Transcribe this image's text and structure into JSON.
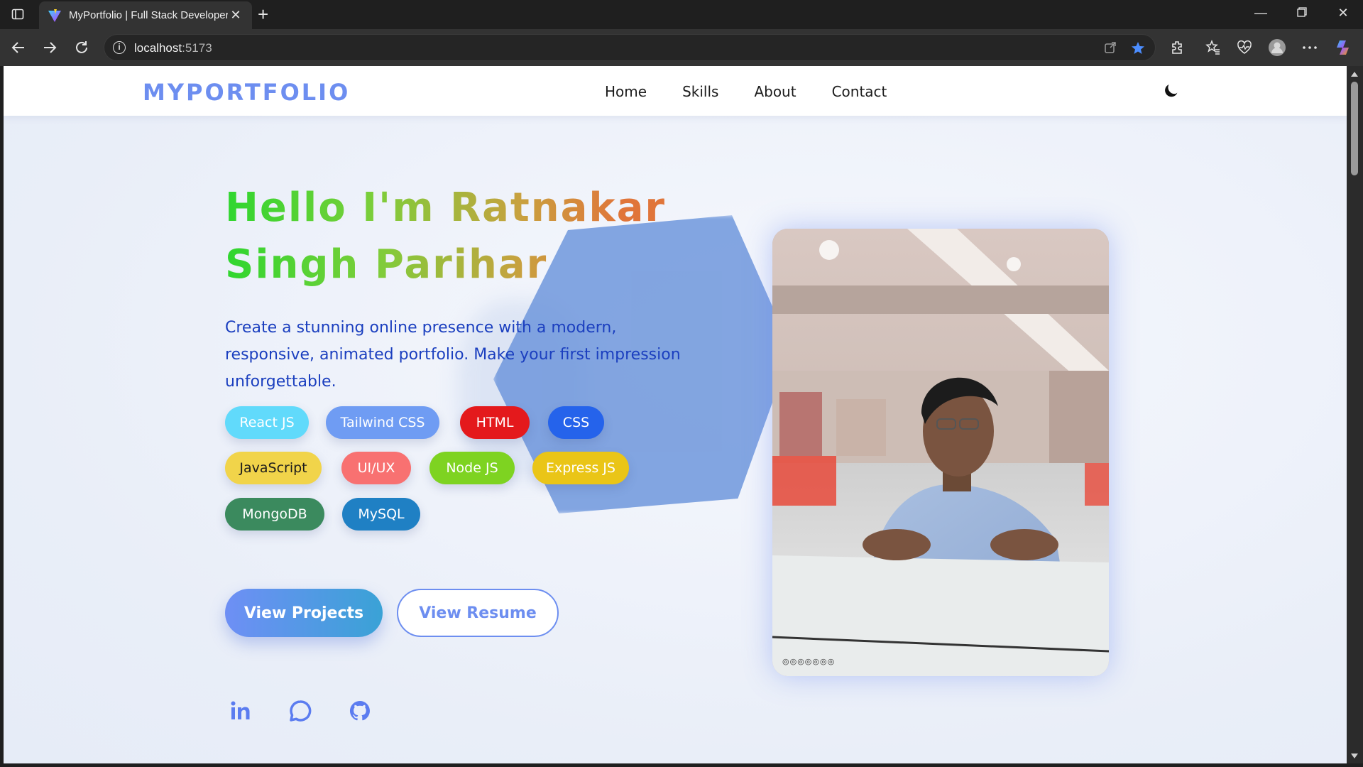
{
  "browser": {
    "tab_title": "MyPortfolio | Full Stack Developer",
    "url_host": "localhost",
    "url_port": ":5173"
  },
  "nav": {
    "logo": "MYPORTFOLIO",
    "links": [
      "Home",
      "Skills",
      "About",
      "Contact"
    ]
  },
  "hero": {
    "title_line1": "Hello I'm Ratnakar",
    "title_line2": "Singh Parihar",
    "description": "Create a stunning online presence with a modern, responsive, animated portfolio. Make your first impression unforgettable.",
    "skills": [
      {
        "label": "React JS",
        "color": "#61dafb"
      },
      {
        "label": "Tailwind CSS",
        "color": "#6f9cf3"
      },
      {
        "label": "HTML",
        "color": "#e4191c"
      },
      {
        "label": "CSS",
        "color": "#2563eb"
      },
      {
        "label": "JavaScript",
        "color": "#f1d44a"
      },
      {
        "label": "UI/UX",
        "color": "#f87171"
      },
      {
        "label": "Node JS",
        "color": "#7ed321"
      },
      {
        "label": "Express JS",
        "color": "#eac517"
      },
      {
        "label": "MongoDB",
        "color": "#3b8a5e"
      },
      {
        "label": "MySQL",
        "color": "#1f80c4"
      }
    ],
    "primary_button": "View Projects",
    "secondary_button": "View Resume",
    "socials": [
      "linkedin-icon",
      "message-icon",
      "github-icon"
    ]
  },
  "photo": {
    "caption": "◎◎◎◎◎◎◎"
  },
  "colors": {
    "accent": "#6d8ef0",
    "description": "#1b3fbf"
  }
}
